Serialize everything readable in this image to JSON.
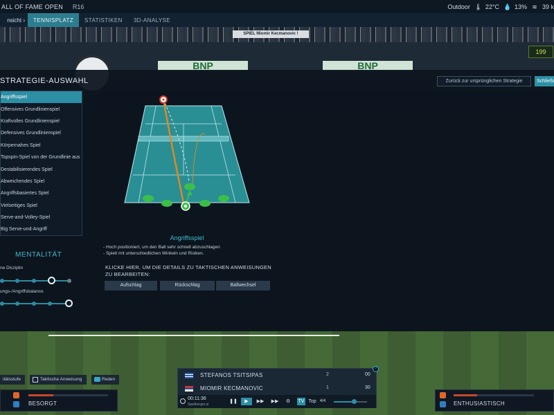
{
  "topbar": {
    "tournament": "ALL OF FAME OPEN",
    "round": "R16",
    "venue": "Outdoor",
    "temp": "22°C",
    "humidity": "13%",
    "wind": "39 k",
    "icons": [
      "thermometer-icon",
      "humidity-icon",
      "wind-icon"
    ]
  },
  "tabs": {
    "view_label": "nsicht ›",
    "items": [
      "TENNISPLATZ",
      "STATISTIKEN",
      "3D-ANALYSE"
    ],
    "active": "TENNISPLATZ"
  },
  "background": {
    "match_banner": "SPIEL Miomir Kecmanovic !",
    "sponsor_bnp": "BNP",
    "clock": "199"
  },
  "strategy": {
    "title": "STRATEGIE-AUSWAHL",
    "items": [
      "Angriffsspiel",
      "Offensives Grundlinienspiel",
      "Kraftvolles Grundlinienspiel",
      "Defensives Grundlinienspiel",
      "Körpernahes Spiel",
      "Topspin-Spiel von der Grundlinie aus",
      "Destabilisierendes Spiel",
      "Abweichendes Spiel",
      "Angriffsbasiertes Spiel",
      "Vielseitiges Spiel",
      "Serve-and-Volley-Spiel",
      "Big Serve-und-Angriff"
    ],
    "selected_index": 0,
    "selected_name": "Angriffsspiel",
    "description": [
      "- Hoch positioniert, um den Ball sehr schnell abzuschlagen",
      "- Spielt mit unterschiedlichen Winkeln und Risiken."
    ],
    "click_hint": "KLICKE HIER, UM DIE DETAILS ZU TAKTISCHEN ANWEISUNGEN ZU BEARBEITEN:",
    "tactic_buttons": [
      "Aufschlag",
      "Rückschlag",
      "Ballwechsel"
    ],
    "reset_button": "Zurück zur ursprünglichen Strategie",
    "close_button": "Schließen"
  },
  "mentality": {
    "title": "MENTALITÄT",
    "sliders": [
      {
        "label": "ne Disziplin",
        "steps": 5,
        "value_index": 3
      },
      {
        "label": "ungs-/Angriffsbalance",
        "steps": 5,
        "value_index": 4
      }
    ]
  },
  "bottom_left": {
    "buttons": [
      "itätsstufe",
      "Taktische Anweisung",
      "Reden"
    ],
    "mood_label": "BESORGT"
  },
  "bottom_right": {
    "mood_label": "ENTHUSIASTISCH"
  },
  "scoreboard": {
    "players": [
      {
        "name": "STEFANOS TSITSIPAS",
        "sets": "2",
        "game": "00"
      },
      {
        "name": "MIOMIR KECMANOVIC",
        "sets": "1",
        "game": "30"
      }
    ],
    "time": "00:11:36",
    "site": "Spielberger.sl",
    "controls": [
      "pause-icon",
      "play-icon",
      "fast-forward-icon",
      "faster-forward-icon",
      "camera-icon"
    ],
    "tv_label": "TV",
    "top_label": "Top",
    "ratio_label": "4/4"
  },
  "colors": {
    "accent": "#2c8fa5",
    "court": "#2a8f95",
    "trajectory": "#e08a1e",
    "positions": "#3bbf4a"
  }
}
